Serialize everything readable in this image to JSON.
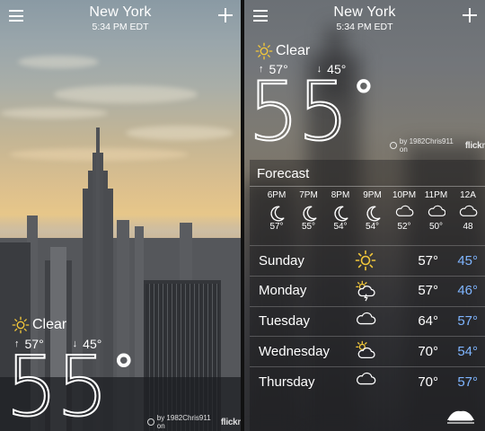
{
  "left": {
    "header": {
      "city": "New York",
      "time": "5:34 PM EDT"
    },
    "current": {
      "condition": "Clear",
      "high": "57°",
      "low": "45°",
      "temp": "55",
      "degree": "°"
    },
    "credit": {
      "text": "by 1982Chris911 on",
      "brand_main": "flick",
      "brand_tail": "r"
    }
  },
  "right": {
    "header": {
      "city": "New York",
      "time": "5:34 PM EDT"
    },
    "current": {
      "condition": "Clear",
      "high": "57°",
      "low": "45°",
      "temp": "55",
      "degree": "°"
    },
    "credit": {
      "text": "by 1982Chris911 on",
      "brand_main": "flick",
      "brand_tail": "r"
    },
    "forecast": {
      "title": "Forecast",
      "hourly": [
        {
          "time": "6PM",
          "icon": "moon-icon",
          "temp": "57°"
        },
        {
          "time": "7PM",
          "icon": "moon-icon",
          "temp": "55°"
        },
        {
          "time": "8PM",
          "icon": "moon-icon",
          "temp": "54°"
        },
        {
          "time": "9PM",
          "icon": "moon-icon",
          "temp": "54°"
        },
        {
          "time": "10PM",
          "icon": "cloud-icon",
          "temp": "52°"
        },
        {
          "time": "11PM",
          "icon": "cloud-icon",
          "temp": "50°"
        },
        {
          "time": "12A",
          "icon": "cloud-icon",
          "temp": "48"
        }
      ],
      "daily": [
        {
          "day": "Sunday",
          "icon": "sun-icon",
          "high": "57°",
          "low": "45°"
        },
        {
          "day": "Monday",
          "icon": "thunderstorm-icon",
          "high": "57°",
          "low": "46°"
        },
        {
          "day": "Tuesday",
          "icon": "cloud-icon",
          "high": "64°",
          "low": "57°"
        },
        {
          "day": "Wednesday",
          "icon": "partly-cloudy-icon",
          "high": "70°",
          "low": "54°"
        },
        {
          "day": "Thursday",
          "icon": "cloud-icon",
          "high": "70°",
          "low": "57°"
        }
      ]
    }
  },
  "colors": {
    "sun": "#f3c83a",
    "low_temp": "#7fb5ff",
    "text": "#ffffff"
  }
}
